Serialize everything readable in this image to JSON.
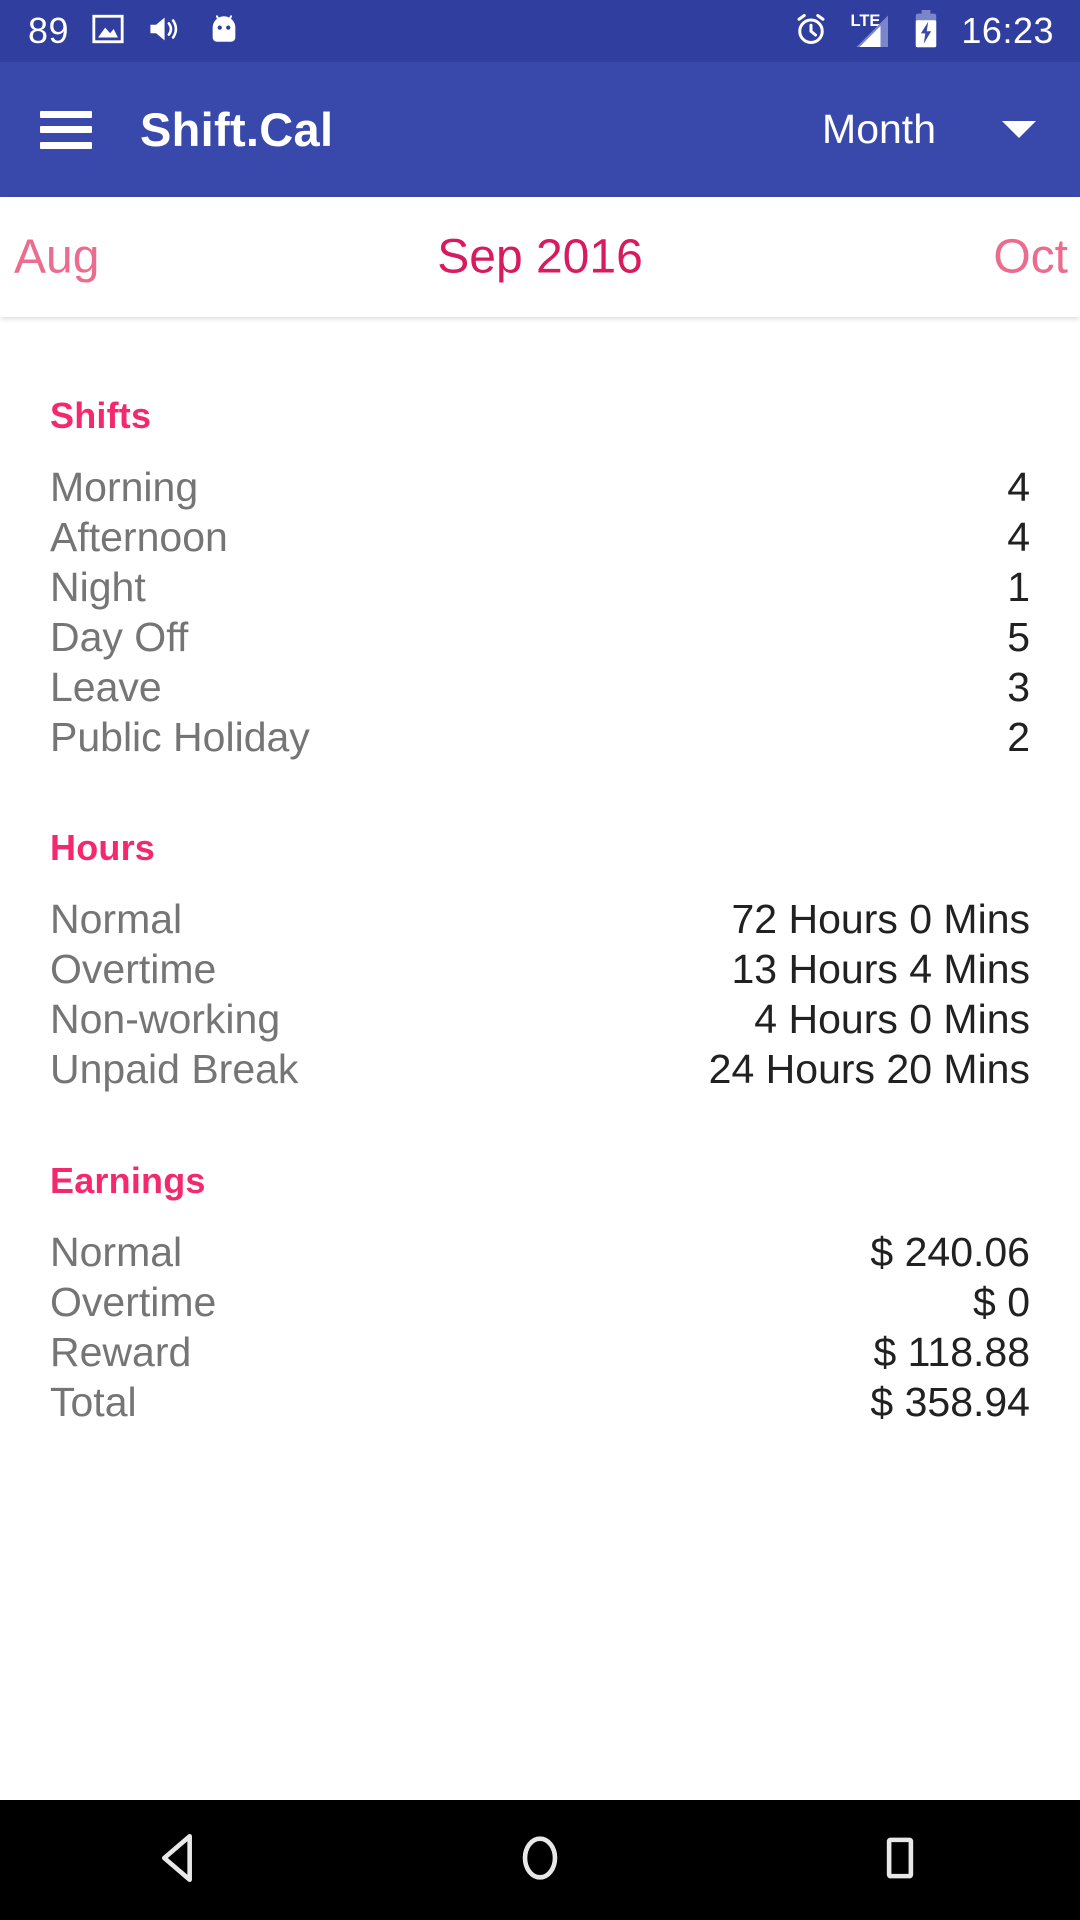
{
  "status_bar": {
    "notification_count": "89",
    "icons": [
      "image-icon",
      "volume-icon",
      "android-icon"
    ],
    "alarm_icon": "alarm-icon",
    "network_label": "LTE",
    "battery_icon": "battery-charging-icon",
    "clock": "16:23",
    "background_color": "#303f9f"
  },
  "app_bar": {
    "menu_icon": "hamburger-menu-icon",
    "title": "Shift.Cal",
    "view_selector": "Month",
    "dropdown_icon": "chevron-down-icon",
    "background_color": "#3949ab"
  },
  "month_nav": {
    "previous": "Aug",
    "current": "Sep 2016",
    "next": "Oct",
    "current_color": "#d81b5e",
    "adjacent_color": "#ec6c8f"
  },
  "sections": [
    {
      "title": "Shifts",
      "rows": [
        {
          "label": "Morning",
          "value": "4"
        },
        {
          "label": "Afternoon",
          "value": "4"
        },
        {
          "label": "Night",
          "value": "1"
        },
        {
          "label": "Day Off",
          "value": "5"
        },
        {
          "label": "Leave",
          "value": "3"
        },
        {
          "label": "Public Holiday",
          "value": "2"
        }
      ]
    },
    {
      "title": "Hours",
      "rows": [
        {
          "label": "Normal",
          "value": "72 Hours 0 Mins"
        },
        {
          "label": "Overtime",
          "value": "13 Hours 4 Mins"
        },
        {
          "label": "Non-working",
          "value": "4 Hours 0 Mins"
        },
        {
          "label": "Unpaid Break",
          "value": "24 Hours 20 Mins"
        }
      ]
    },
    {
      "title": "Earnings",
      "rows": [
        {
          "label": "Normal",
          "value": "$ 240.06"
        },
        {
          "label": "Overtime",
          "value": "$ 0"
        },
        {
          "label": "Reward",
          "value": "$ 118.88"
        },
        {
          "label": "Total",
          "value": "$ 358.94"
        }
      ]
    }
  ],
  "nav_bar": {
    "back": "back-triangle-icon",
    "home": "home-circle-icon",
    "recents": "recents-square-icon",
    "background_color": "#000000"
  },
  "theme": {
    "section_heading_color": "#f4286d",
    "label_color": "#757575",
    "value_color": "#212121"
  }
}
